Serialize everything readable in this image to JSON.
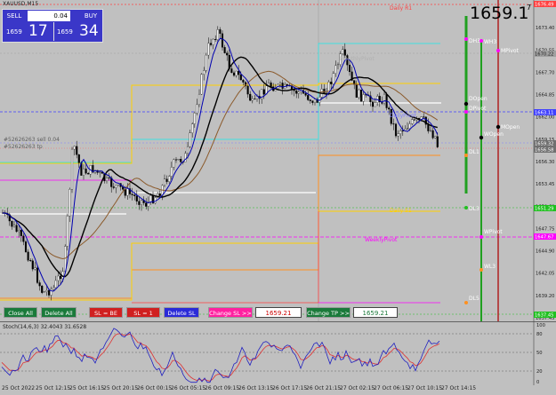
{
  "top_label": "XAUUSD,M15",
  "big_price": "1659.1",
  "big_price_sup": "7",
  "trade_panel": {
    "sell_label": "SELL",
    "buy_label": "BUY",
    "lots": "0.04",
    "sell_small": "1659",
    "sell_big": "17",
    "buy_small": "1659",
    "buy_big": "34"
  },
  "buttons": {
    "close_all": "Close All",
    "delete_all": "Delete All",
    "sl_be": "SL = BE",
    "sl_1": "SL = 1",
    "delete_sl": "Delete SL",
    "change_sl": "Change SL >>",
    "sl_value": "1659.21",
    "change_tp": "Change TP >>",
    "tp_value": "1659.21"
  },
  "price_axis": [
    "1676.40",
    "1673.40",
    "1670.55",
    "1667.70",
    "1664.85",
    "1662.00",
    "1659.15",
    "1656.30",
    "1653.45",
    "1650.60",
    "1647.75",
    "1644.90",
    "1642.05",
    "1639.20",
    "1637.45"
  ],
  "price_tags": {
    "top_red": "1676.49",
    "pivot_top": "1670.22",
    "blue_line": "1663.11",
    "current": "1659.32",
    "current2": "1656.58",
    "green_line": "1651.29",
    "weekly_pivot": "1647.67",
    "bottom_green": "1637.45"
  },
  "chart_labels": {
    "daily_r1": "Daily R1",
    "monthly_pivot": "MonthlyPivot",
    "daily_pivot": "DailyPivot",
    "weekly_pivot": "WeeklyPivot",
    "daily_s1": "Daily S1",
    "order1": "#52626263 sell 0.04",
    "order2": "#52626263 tp",
    "dh3": "DH3",
    "wh3": "WH3",
    "mpivot": "MPivot",
    "dopen": "DOpen",
    "dpivot": "DPivot",
    "wopen": "WOpen",
    "mopen": "MOpen",
    "dl3": "DL3",
    "dl1": "DL1",
    "wpivot": "WPivot",
    "wl3": "WL3",
    "dl5": "DL5",
    "dl": "DL"
  },
  "oscillator": {
    "title": "Stoch(14,6,3) 32.4043 31.6528",
    "levels": [
      "100",
      "80",
      "50",
      "20",
      "0"
    ]
  },
  "time_axis": [
    "25 Oct 2022",
    "25 Oct 12:15",
    "25 Oct 16:15",
    "25 Oct 20:15",
    "26 Oct 00:15",
    "26 Oct 05:15",
    "26 Oct 09:15",
    "26 Oct 13:15",
    "26 Oct 17:15",
    "26 Oct 21:15",
    "27 Oct 02:15",
    "27 Oct 06:15",
    "27 Oct 10:15",
    "27 Oct 14:15"
  ],
  "colors": {
    "background": "#c0c0c0",
    "candles": "#000000",
    "ma_blue": "#0000b0",
    "ma_black": "#000000",
    "ma_brown": "#8b5a2b",
    "daily_r1": "#ff4040",
    "pivot_cyan": "#40e0e0",
    "pivot_yellow": "#ffd000",
    "pivot_orange": "#ff9020",
    "weekly_magenta": "#ff00ff",
    "blue_dash": "#4040ff",
    "green_dash": "#20c020"
  }
}
